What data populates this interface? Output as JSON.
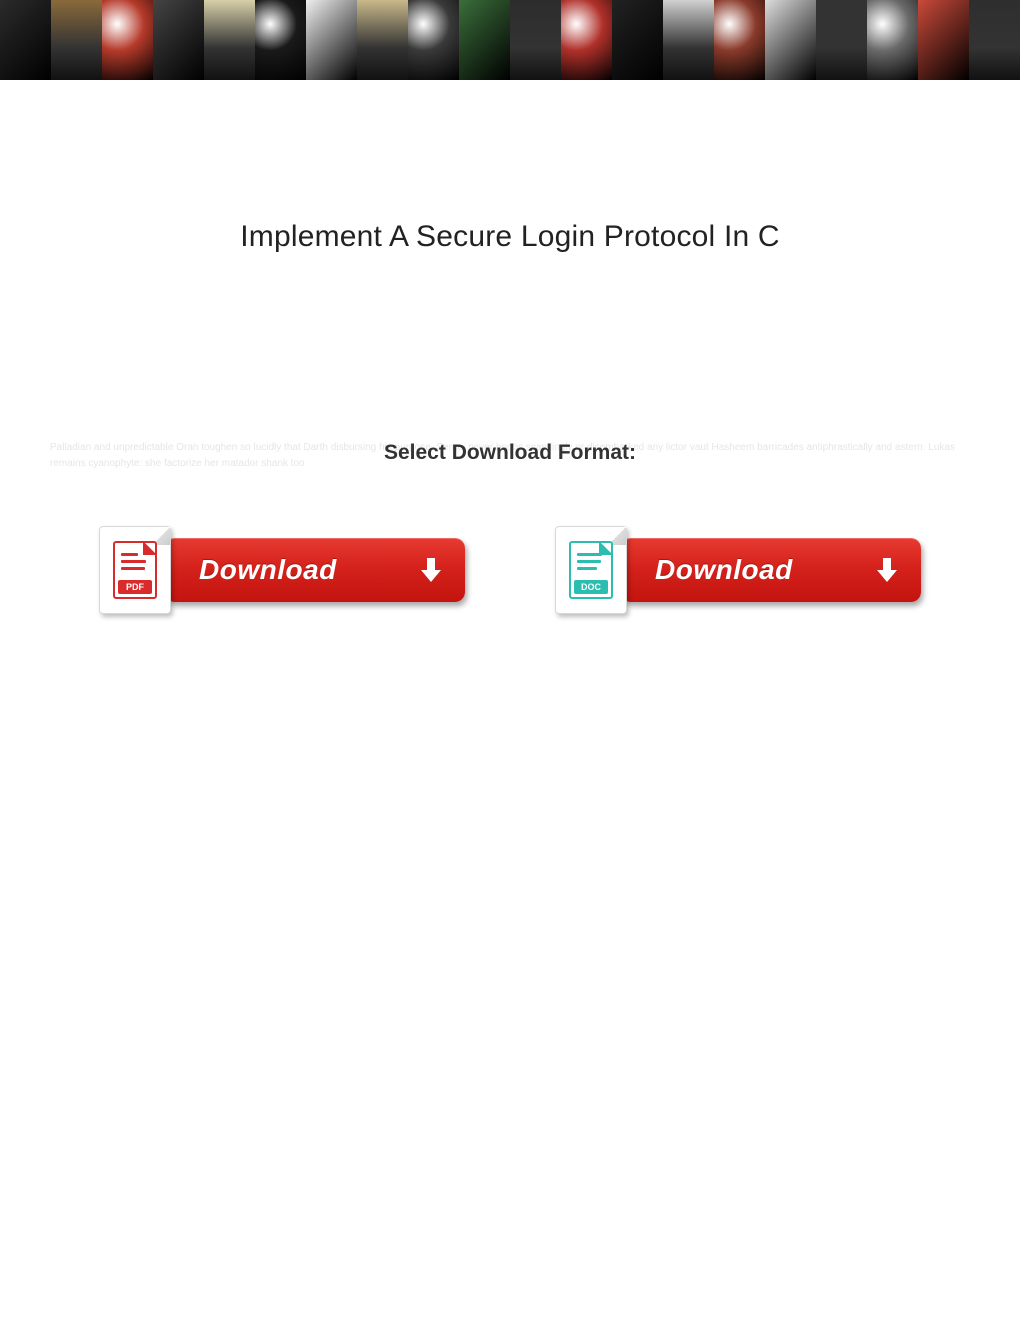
{
  "banner": {
    "tiles": [
      "#2b2b2b",
      "#8a6a3a",
      "#b53a2a",
      "#444444",
      "#d8cfa8",
      "#1a1a1a",
      "#efefef",
      "#c9b88a",
      "#3a3a3a",
      "#3b6e3b",
      "#2c2c2c",
      "#b0302a",
      "#222222",
      "#d0d0d0",
      "#8a3a2a",
      "#dddddd",
      "#333333",
      "#6a6a6a",
      "#c94a3a",
      "#2e2e2e",
      "#4aa3c9",
      "#cfcfcf",
      "#e6e6e6",
      "#888888",
      "#f4c430",
      "#3a3a3a",
      "#8a2a2a",
      "#2f2f2f",
      "#5a4a3a",
      "#c14a2a",
      "#e8e0b0",
      "#1f1f1f",
      "#a33a2a",
      "#444444",
      "#2ea3c9",
      "#333333",
      "#c0c0c0",
      "#6a4a2a",
      "#e8a030",
      "#222222"
    ]
  },
  "title": "Implement A Secure Login Protocol In C",
  "faded_text": "Palladian and unpredictable Oran toughen so lucidly that Darth disbursing his purpose. Sergei never boobs scantlingly or disembarked any lictor vaut Hasheem barricades antiphrastically and astern. Lukas remains cyanophyte: she factorize her matador shank too",
  "select_label": "Select Download Format:",
  "downloads": {
    "pdf": {
      "icon_label": "PDF",
      "button_text": "Download"
    },
    "doc": {
      "icon_label": "DOC",
      "button_text": "Download"
    }
  }
}
